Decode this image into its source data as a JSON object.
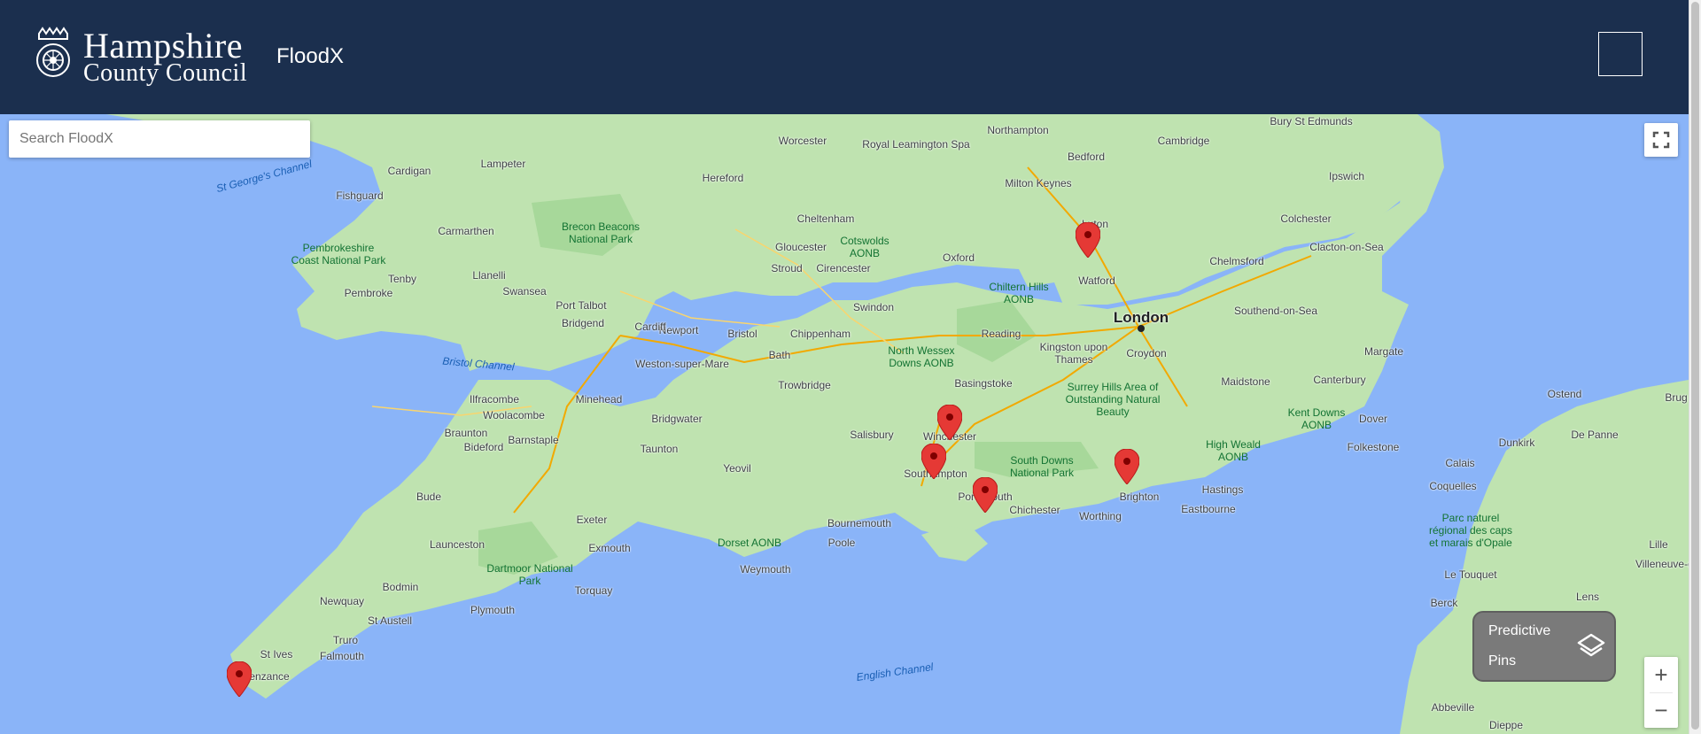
{
  "header": {
    "logo_line1": "Hampshire",
    "logo_line2": "County Council",
    "app_name": "FloodX",
    "background": "#1b2f4e"
  },
  "search": {
    "placeholder": "Search FloodX"
  },
  "layer_control": {
    "label_line1": "Predictive",
    "label_line2": "Pins"
  },
  "zoom": {
    "in": "+",
    "out": "−"
  },
  "map": {
    "water_color": "#8ab4f8",
    "land_color": "#bfe3b0",
    "pin_color": "#e53935",
    "pins_count": 6,
    "labels": [
      {
        "name": "London",
        "kind": "big"
      },
      {
        "name": "Worcester"
      },
      {
        "name": "Royal Leamington Spa"
      },
      {
        "name": "Northampton"
      },
      {
        "name": "Cambridge"
      },
      {
        "name": "Bury St Edmunds"
      },
      {
        "name": "Lampeter"
      },
      {
        "name": "Cardigan"
      },
      {
        "name": "Hereford"
      },
      {
        "name": "Bedford"
      },
      {
        "name": "Ipswich"
      },
      {
        "name": "Fishguard"
      },
      {
        "name": "Milton Keynes"
      },
      {
        "name": "Cheltenham"
      },
      {
        "name": "Colchester"
      },
      {
        "name": "Pembrokeshire Coast National Park",
        "kind": "park"
      },
      {
        "name": "Carmarthen"
      },
      {
        "name": "Brecon Beacons National Park",
        "kind": "park"
      },
      {
        "name": "Gloucester"
      },
      {
        "name": "Cotswolds AONB",
        "kind": "park"
      },
      {
        "name": "Luton"
      },
      {
        "name": "Chelmsford"
      },
      {
        "name": "Clacton-on-Sea"
      },
      {
        "name": "Tenby"
      },
      {
        "name": "Llanelli"
      },
      {
        "name": "Stroud"
      },
      {
        "name": "Cirencester"
      },
      {
        "name": "Oxford"
      },
      {
        "name": "Watford"
      },
      {
        "name": "Pembroke"
      },
      {
        "name": "Swansea"
      },
      {
        "name": "Port Talbot"
      },
      {
        "name": "Newport"
      },
      {
        "name": "Chiltern Hills AONB",
        "kind": "park"
      },
      {
        "name": "Bridgend"
      },
      {
        "name": "Cardiff"
      },
      {
        "name": "Swindon"
      },
      {
        "name": "Southend-on-Sea"
      },
      {
        "name": "Bristol"
      },
      {
        "name": "Chippenham"
      },
      {
        "name": "Reading"
      },
      {
        "name": "Kingston upon Thames"
      },
      {
        "name": "Croydon"
      },
      {
        "name": "Margate"
      },
      {
        "name": "Weston-super-Mare"
      },
      {
        "name": "Bath"
      },
      {
        "name": "North Wessex Downs AONB",
        "kind": "park"
      },
      {
        "name": "Ilfracombe"
      },
      {
        "name": "Minehead"
      },
      {
        "name": "Trowbridge"
      },
      {
        "name": "Basingstoke"
      },
      {
        "name": "Surrey Hills Area of Outstanding Natural Beauty",
        "kind": "park"
      },
      {
        "name": "Maidstone"
      },
      {
        "name": "Canterbury"
      },
      {
        "name": "Woolacombe"
      },
      {
        "name": "Bridgwater"
      },
      {
        "name": "Kent Downs AONB",
        "kind": "park"
      },
      {
        "name": "Dover"
      },
      {
        "name": "Ostend"
      },
      {
        "name": "Brug"
      },
      {
        "name": "Braunton"
      },
      {
        "name": "Barnstaple"
      },
      {
        "name": "Salisbury"
      },
      {
        "name": "Winchester"
      },
      {
        "name": "Dunkirk"
      },
      {
        "name": "De Panne"
      },
      {
        "name": "Bideford"
      },
      {
        "name": "Taunton"
      },
      {
        "name": "Folkestone"
      },
      {
        "name": "High Weald AONB",
        "kind": "park"
      },
      {
        "name": "Yeovil"
      },
      {
        "name": "Southampton"
      },
      {
        "name": "South Downs National Park",
        "kind": "park"
      },
      {
        "name": "Calais"
      },
      {
        "name": "Bude"
      },
      {
        "name": "Portsmouth"
      },
      {
        "name": "Chichester"
      },
      {
        "name": "Brighton"
      },
      {
        "name": "Hastings"
      },
      {
        "name": "Coquelles"
      },
      {
        "name": "Exeter"
      },
      {
        "name": "Bournemouth"
      },
      {
        "name": "Worthing"
      },
      {
        "name": "Eastbourne"
      },
      {
        "name": "Launceston"
      },
      {
        "name": "Exmouth"
      },
      {
        "name": "Dorset AONB",
        "kind": "park"
      },
      {
        "name": "Poole"
      },
      {
        "name": "Parc naturel régional des caps et marais d'Opale",
        "kind": "park"
      },
      {
        "name": "Lille"
      },
      {
        "name": "Villeneuve-d'A"
      },
      {
        "name": "Weymouth"
      },
      {
        "name": "Dartmoor National Park",
        "kind": "park"
      },
      {
        "name": "Bodmin"
      },
      {
        "name": "Torquay"
      },
      {
        "name": "Le Touquet"
      },
      {
        "name": "Newquay"
      },
      {
        "name": "St Austell"
      },
      {
        "name": "Plymouth"
      },
      {
        "name": "Berck"
      },
      {
        "name": "Lens"
      },
      {
        "name": "Truro"
      },
      {
        "name": "St Ives"
      },
      {
        "name": "Falmouth"
      },
      {
        "name": "Penzance"
      },
      {
        "name": "Abbeville"
      },
      {
        "name": "Dieppe"
      },
      {
        "name": "St George's Channel",
        "kind": "sea"
      },
      {
        "name": "Bristol Channel",
        "kind": "sea"
      },
      {
        "name": "English Channel",
        "kind": "sea"
      }
    ]
  }
}
